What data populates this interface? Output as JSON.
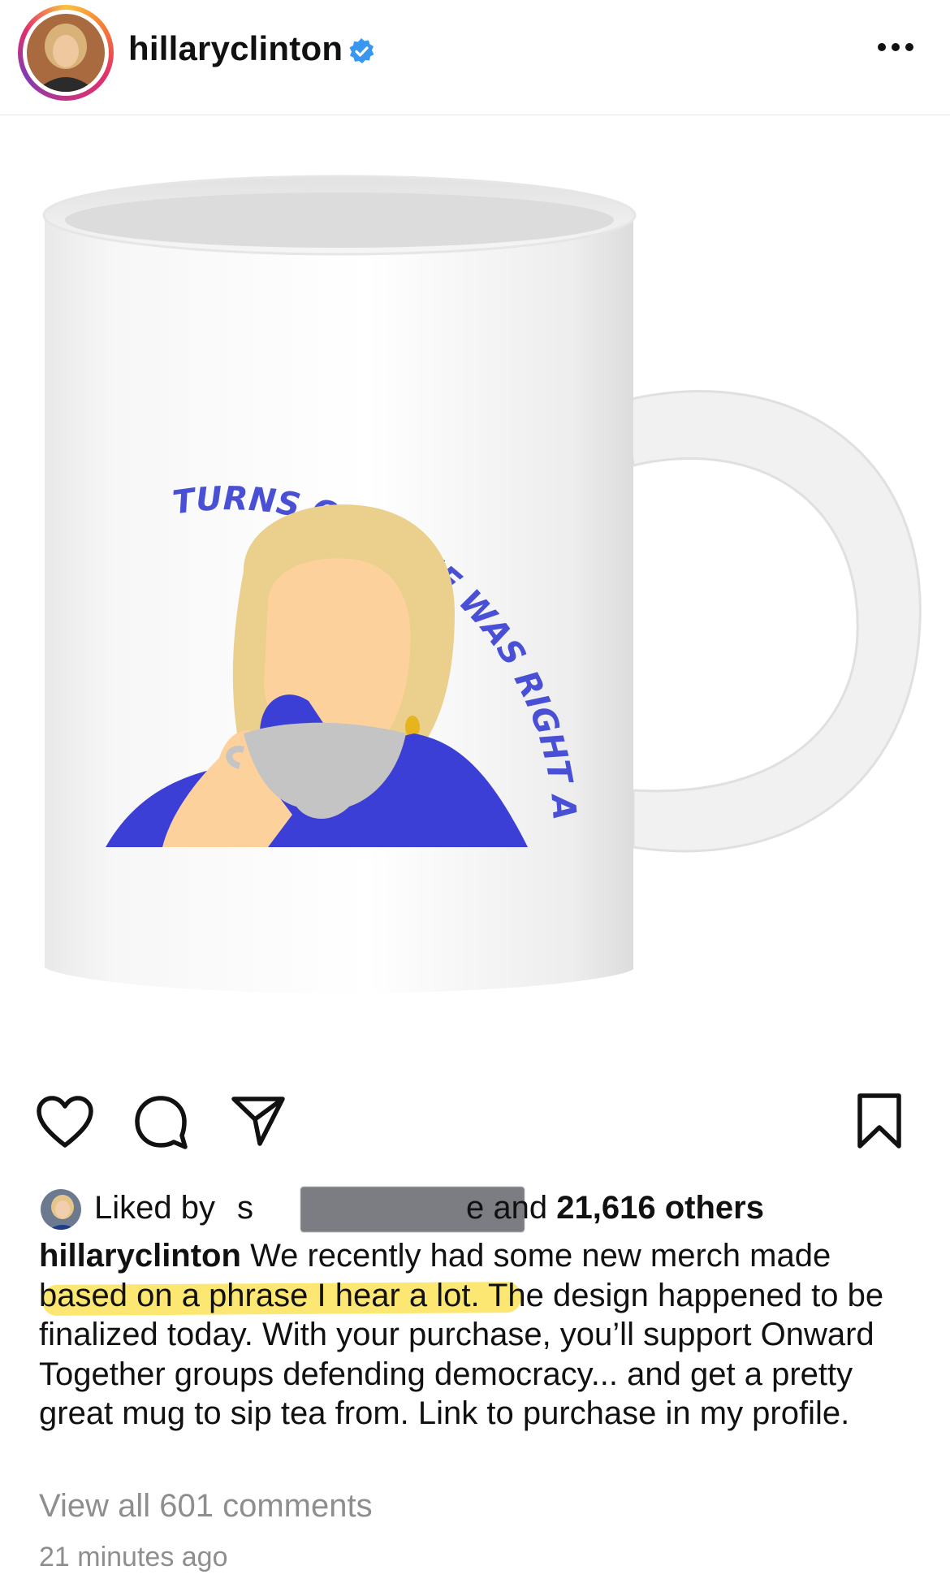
{
  "header": {
    "username": "hillaryclinton",
    "verified_icon": "verified-badge-icon",
    "more_icon": "more-options-icon",
    "accent": "#3897f0"
  },
  "post": {
    "image_alt_text": "TURNS OUT SHE WAS RIGHT ABOUT EVERYTHING"
  },
  "actions": {
    "like_icon": "heart-icon",
    "comment_icon": "comment-icon",
    "share_icon": "send-icon",
    "save_icon": "bookmark-icon"
  },
  "likes": {
    "prefix": "Liked by",
    "partial_name_start": "s",
    "partial_name_end": "e",
    "suffix_and": "and",
    "count_text": "21,616 others"
  },
  "caption": {
    "username": "hillaryclinton",
    "text_before_highlight": "We recently had some new merch made ",
    "highlighted": "based on a phrase I hear a lot.",
    "text_after_highlight": " The design happened to be finalized today. With your purchase, you’ll support Onward Together groups defending democracy... and get a pretty great mug to sip tea from. Link to purchase in my profile."
  },
  "comments": {
    "view_all": "View all 601 comments"
  },
  "meta": {
    "timestamp": "21 minutes ago"
  },
  "colors": {
    "mug_text": "#4a50d6",
    "hair": "#ead08c",
    "skin": "#fcd19b",
    "jacket": "#3c3fd6",
    "cup": "#c4c4c4",
    "highlight": "#fbe35a"
  }
}
